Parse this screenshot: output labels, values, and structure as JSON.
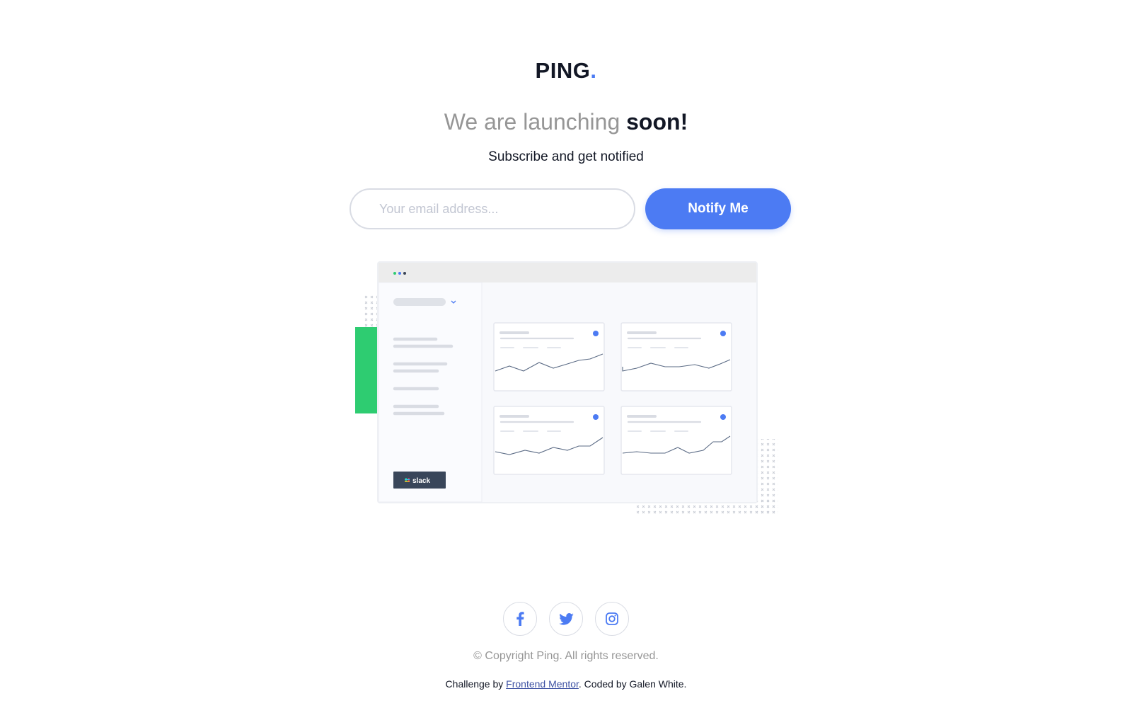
{
  "brand": {
    "name": "PING",
    "dot": ".",
    "dot_color": "#4c7bf3"
  },
  "hero": {
    "headline_light": "We are launching ",
    "headline_bold": "soon!",
    "subheading": "Subscribe and get notified"
  },
  "signup": {
    "email_placeholder": "Your email address...",
    "email_value": "",
    "button_label": "Notify Me",
    "accent": "#4c7bf3"
  },
  "illustration": {
    "sidebar_button_label": "slack",
    "decor_color": "#2ecc71",
    "card_count": 4,
    "icons": [
      "window-dots-icon",
      "dropdown-chevron-icon",
      "check-badge-icon",
      "sparkline-chart"
    ]
  },
  "social": [
    {
      "name": "facebook",
      "icon": "facebook-icon"
    },
    {
      "name": "twitter",
      "icon": "twitter-icon"
    },
    {
      "name": "instagram",
      "icon": "instagram-icon"
    }
  ],
  "footer": {
    "copyright": "© Copyright Ping. All rights reserved.",
    "challenge_prefix": "Challenge by ",
    "challenge_link": "Frontend Mentor",
    "coded_by": ". Coded by Galen White."
  }
}
